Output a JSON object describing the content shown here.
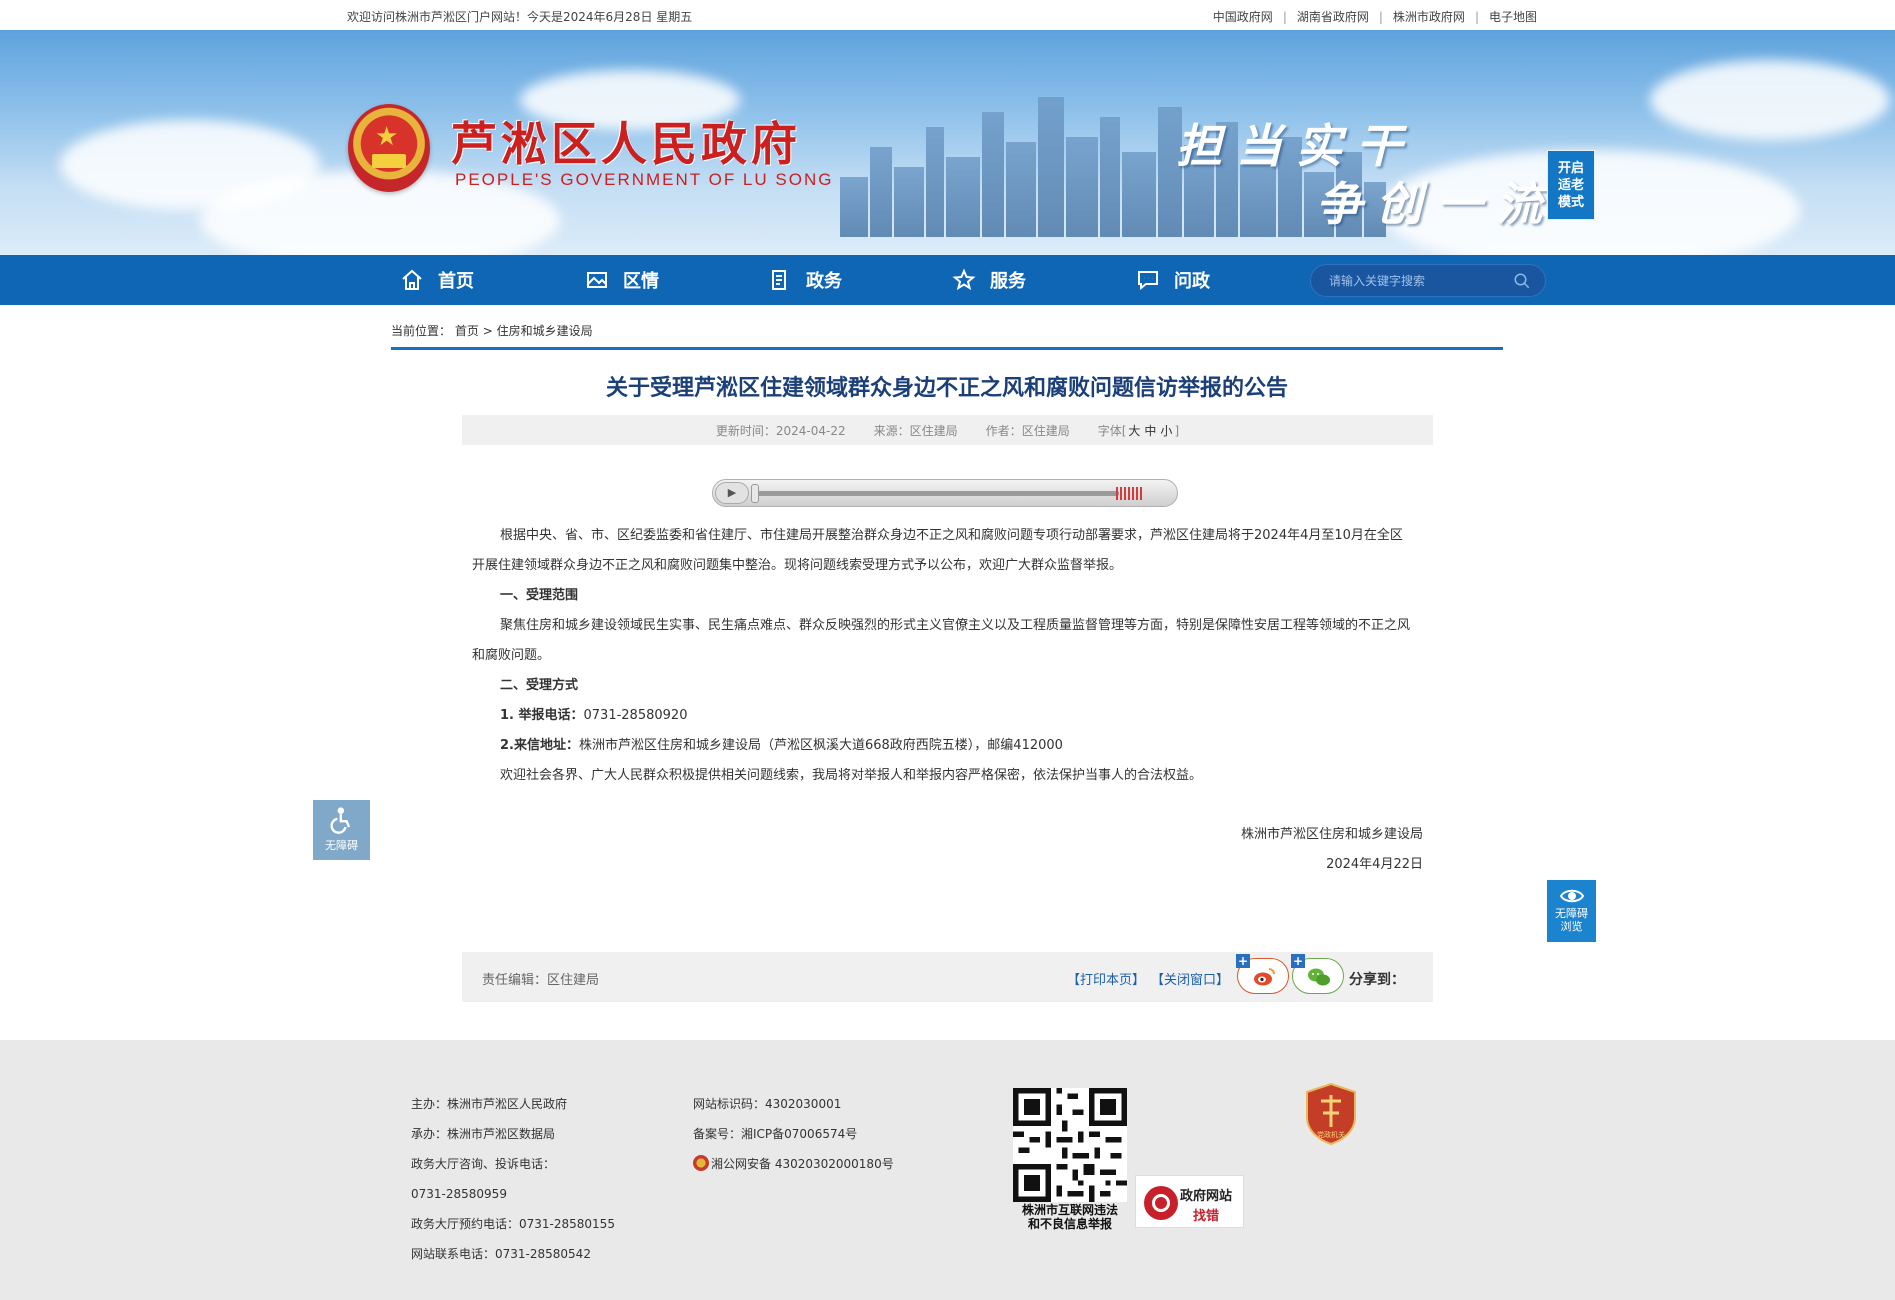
{
  "topbar": {
    "welcome": "欢迎访问株洲市芦淞区门户网站！今天是2024年6月28日 星期五",
    "links": [
      "中国政府网",
      "湖南省政府网",
      "株洲市政府网",
      "电子地图"
    ]
  },
  "banner": {
    "title": "芦淞区人民政府",
    "subtitle": "PEOPLE'S GOVERNMENT OF  LU SONG",
    "slogan_line1": "担当实干",
    "slogan_line2": "争创一流",
    "elder_mode": [
      "开启",
      "适老",
      "模式"
    ]
  },
  "nav": {
    "items": [
      {
        "label": "首页",
        "icon": "home-icon"
      },
      {
        "label": "区情",
        "icon": "picture-icon"
      },
      {
        "label": "政务",
        "icon": "document-icon"
      },
      {
        "label": "服务",
        "icon": "star-icon"
      },
      {
        "label": "问政",
        "icon": "chat-icon"
      }
    ],
    "search_placeholder": "请输入关键字搜索"
  },
  "breadcrumb": {
    "prefix": "当前位置：",
    "home": "首页",
    "sep": ">",
    "current": "住房和城乡建设局"
  },
  "article": {
    "title": "关于受理芦淞区住建领域群众身边不正之风和腐败问题信访举报的公告",
    "meta": {
      "update_label": "更新时间：",
      "update_value": "2024-04-22",
      "source_label": "来源：",
      "source_value": "区住建局",
      "author_label": "作者：",
      "author_value": "区住建局",
      "font_label": "字体[",
      "font_large": "大",
      "font_medium": "中",
      "font_small": "小",
      "font_end": "]"
    },
    "paragraphs": [
      "根据中央、省、市、区纪委监委和省住建厅、市住建局开展整治群众身边不正之风和腐败问题专项行动部署要求，芦淞区住建局将于2024年4月至10月在全区开展住建领域群众身边不正之风和腐败问题集中整治。现将问题线索受理方式予以公布，欢迎广大群众监督举报。",
      "一、受理范围",
      "聚焦住房和城乡建设领域民生实事、民生痛点难点、群众反映强烈的形式主义官僚主义以及工程质量监督管理等方面，特别是保障性安居工程等领域的不正之风和腐败问题。",
      "二、受理方式"
    ],
    "phone_label": "1. 举报电话：",
    "phone_value": "0731-28580920",
    "address_label": "2.来信地址：",
    "address_value": "株洲市芦淞区住房和城乡建设局（芦淞区枫溪大道668政府西院五楼），邮编412000",
    "closing": "欢迎社会各界、广大人民群众积极提供相关问题线索，我局将对举报人和举报内容严格保密，依法保护当事人的合法权益。",
    "sign_org": "株洲市芦淞区住房和城乡建设局",
    "sign_date": "2024年4月22日"
  },
  "bottom_bar": {
    "editor": "责任编辑：区住建局",
    "print": "【打印本页】",
    "close": "【关闭窗口】",
    "share": "分享到："
  },
  "accessibility": {
    "left_label": "无障碍",
    "right_label_1": "无障碍",
    "right_label_2": "浏览"
  },
  "footer": {
    "col1": [
      "主办：株洲市芦淞区人民政府",
      "承办：株洲市芦淞区数据局",
      "政务大厅咨询、投诉电话：",
      "0731-28580959",
      "政务大厅预约电话：0731-28580155",
      "网站联系电话：0731-28580542"
    ],
    "col2": [
      "网站标识码：4302030001",
      " 备案号：湘ICP备07006574号",
      "湘公网安备 43020302000180号"
    ],
    "qr_caption_1": "株洲市互联网违法",
    "qr_caption_2": "和不良信息举报",
    "zhaocuo_1": "政府网站",
    "zhaocuo_2": "找错",
    "party_badge_text": "党政机关"
  },
  "colors": {
    "nav_blue": "#0f66b5",
    "title_red": "#cc1f1f",
    "article_title_blue": "#1b3f78",
    "link_blue": "#1b5fae"
  }
}
